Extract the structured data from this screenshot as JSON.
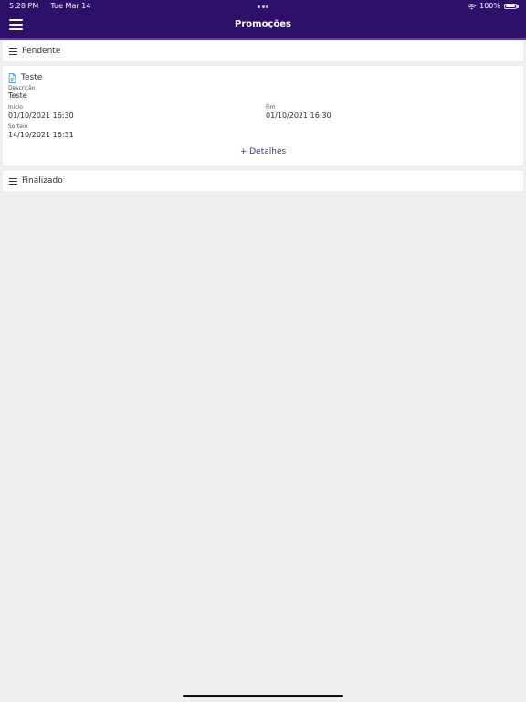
{
  "status_bar": {
    "time": "5:28 PM",
    "date": "Tue Mar 14",
    "battery": "100%",
    "battery_level": 1.0
  },
  "nav": {
    "title": "Promoções"
  },
  "sections": {
    "pending": {
      "label": "Pendente"
    },
    "finished": {
      "label": "Finalizado"
    }
  },
  "promotion": {
    "title": "Teste",
    "description_label": "Descrição",
    "description_value": "Teste",
    "start_label": "Início",
    "start_value": "01/10/2021 16:30",
    "end_label": "Fim",
    "end_value": "01/10/2021 16:30",
    "draw_label": "Sorteio",
    "draw_value": "14/10/2021 16:31",
    "details_label": "+ Detalhes"
  },
  "colors": {
    "header": "#2e0f6a",
    "header_accent": "#5f40b6",
    "page_background": "#efefef",
    "link": "#4a2d85"
  },
  "icons": {
    "menu": "hamburger-icon",
    "section": "list-icon",
    "promotion": "document-icon",
    "wifi": "wifi-icon",
    "battery": "battery-icon"
  }
}
